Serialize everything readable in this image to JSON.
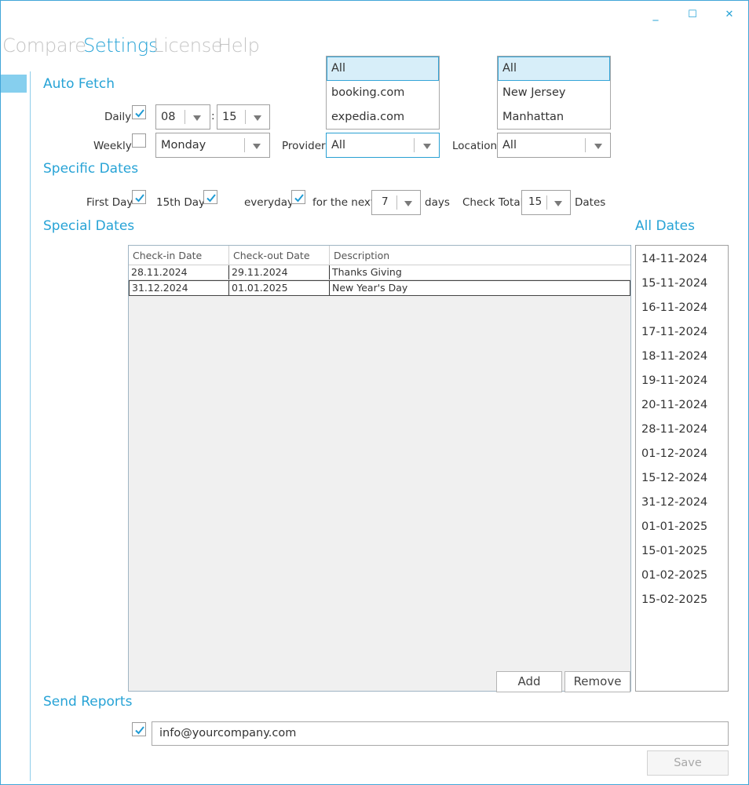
{
  "window_controls": {
    "minimize": "_",
    "maximize": "☐",
    "close": "✕"
  },
  "nav": {
    "compare": "Compare",
    "settings": "Settings",
    "license": "License",
    "help": "Help"
  },
  "auto_fetch": {
    "title": "Auto Fetch",
    "daily_label": "Daily",
    "daily_checked": true,
    "hour": "08",
    "time_sep": ":",
    "minute": "15",
    "weekly_label": "Weekly",
    "weekly_checked": false,
    "weekday": "Monday",
    "provider_label": "Provider",
    "provider_value": "All",
    "provider_options": [
      "All",
      "booking.com",
      "expedia.com"
    ],
    "location_label": "Location",
    "location_value": "All",
    "location_options": [
      "All",
      "New Jersey",
      "Manhattan"
    ]
  },
  "specific_dates": {
    "title": "Specific Dates",
    "first_day_label": "First Day",
    "first_day_checked": true,
    "fifteenth_label": "15th Day",
    "fifteenth_checked": true,
    "everyday_label": "everyday",
    "everyday_checked": true,
    "for_next_label": "for the next",
    "next_value": "7",
    "days_label": "days",
    "check_total_label": "Check Total",
    "check_total_value": "15",
    "dates_label": "Dates"
  },
  "special_dates": {
    "title": "Special Dates",
    "columns": [
      "Check-in Date",
      "Check-out Date",
      "Description"
    ],
    "rows": [
      [
        "28.11.2024",
        "29.11.2024",
        "Thanks Giving"
      ],
      [
        "31.12.2024",
        "01.01.2025",
        "New Year's Day"
      ]
    ],
    "add_label": "Add",
    "remove_label": "Remove"
  },
  "all_dates": {
    "title": "All Dates",
    "items": [
      "14-11-2024",
      "15-11-2024",
      "16-11-2024",
      "17-11-2024",
      "18-11-2024",
      "19-11-2024",
      "20-11-2024",
      "28-11-2024",
      "01-12-2024",
      "15-12-2024",
      "31-12-2024",
      "01-01-2025",
      "15-01-2025",
      "01-02-2025",
      "15-02-2025"
    ]
  },
  "send_reports": {
    "title": "Send Reports",
    "checked": true,
    "email": "info@yourcompany.com",
    "save_label": "Save"
  },
  "colors": {
    "accent": "#27a3d6",
    "selection": "#d7eef9"
  }
}
